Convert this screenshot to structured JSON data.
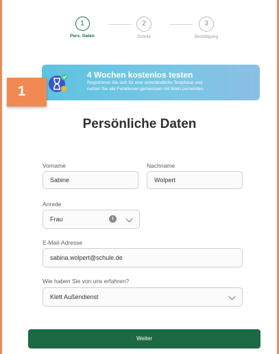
{
  "stepper": {
    "steps": [
      {
        "number": "1",
        "label": "Pers. Daten"
      },
      {
        "number": "2",
        "label": "Schule"
      },
      {
        "number": "3",
        "label": "Bestätigung"
      }
    ]
  },
  "banner": {
    "title": "4 Wochen kostenlos testen",
    "line1": "Registrieren Sie sich für eine unverbindliche Testphase und",
    "line2": "nutzen Sie alle Funktionen gemeinsam mit Ihren Lernenden."
  },
  "callout_number": "1",
  "page_title": "Persönliche Daten",
  "form": {
    "vorname": {
      "label": "Vorname",
      "value": "Sabine"
    },
    "nachname": {
      "label": "Nachname",
      "value": "Wolpert"
    },
    "anrede": {
      "label": "Anrede",
      "value": "Frau"
    },
    "email": {
      "label": "E-Mail-Adresse",
      "value": "sabina.wolpert@schule.de"
    },
    "source": {
      "label": "Wie haben Sie von uns erfahren?",
      "value": "Klett Außendienst"
    }
  },
  "submit_label": "Weiter",
  "colors": {
    "accent": "#1b6a44",
    "banner": "#6cc4e2",
    "badge": "#f08a52"
  }
}
